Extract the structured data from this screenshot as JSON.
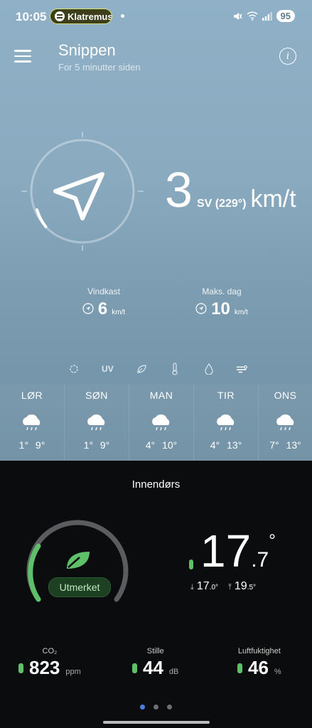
{
  "status": {
    "time": "10:05",
    "spotify_label": "Klatremus",
    "battery": "95"
  },
  "header": {
    "title": "Snippen",
    "subtitle": "For 5 minutter siden"
  },
  "wind": {
    "speed": "3",
    "direction": "SV (229°)",
    "unit": "km/t",
    "gust_label": "Vindkast",
    "gust_value": "6",
    "gust_unit": "km/t",
    "max_label": "Maks. dag",
    "max_value": "10",
    "max_unit": "km/t"
  },
  "params": {
    "uv_label": "UV"
  },
  "forecast": [
    {
      "day": "LØR",
      "temps": "1° 9°"
    },
    {
      "day": "SØN",
      "temps": "1° 9°"
    },
    {
      "day": "MAN",
      "temps": "4° 10°"
    },
    {
      "day": "TIR",
      "temps": "4° 13°"
    },
    {
      "day": "ONS",
      "temps": "7° 13°"
    }
  ],
  "indoor": {
    "title": "Innendørs",
    "quality": "Utmerket",
    "gauge_level": 0.25,
    "temp_int": "17",
    "temp_dec": ".7",
    "temp_deg": "°",
    "min_int": "17",
    "min_dec": ".0",
    "max_int": "19",
    "max_dec": ".5",
    "co2_label": "CO₂",
    "co2_value": "823",
    "co2_unit": "ppm",
    "noise_label": "Stille",
    "noise_value": "44",
    "noise_unit": "dB",
    "humidity_label": "Luftfuktighet",
    "humidity_value": "46",
    "humidity_unit": "%"
  },
  "colors": {
    "accent_green": "#5ec16a",
    "page_dot_active": "#4b7dea"
  }
}
